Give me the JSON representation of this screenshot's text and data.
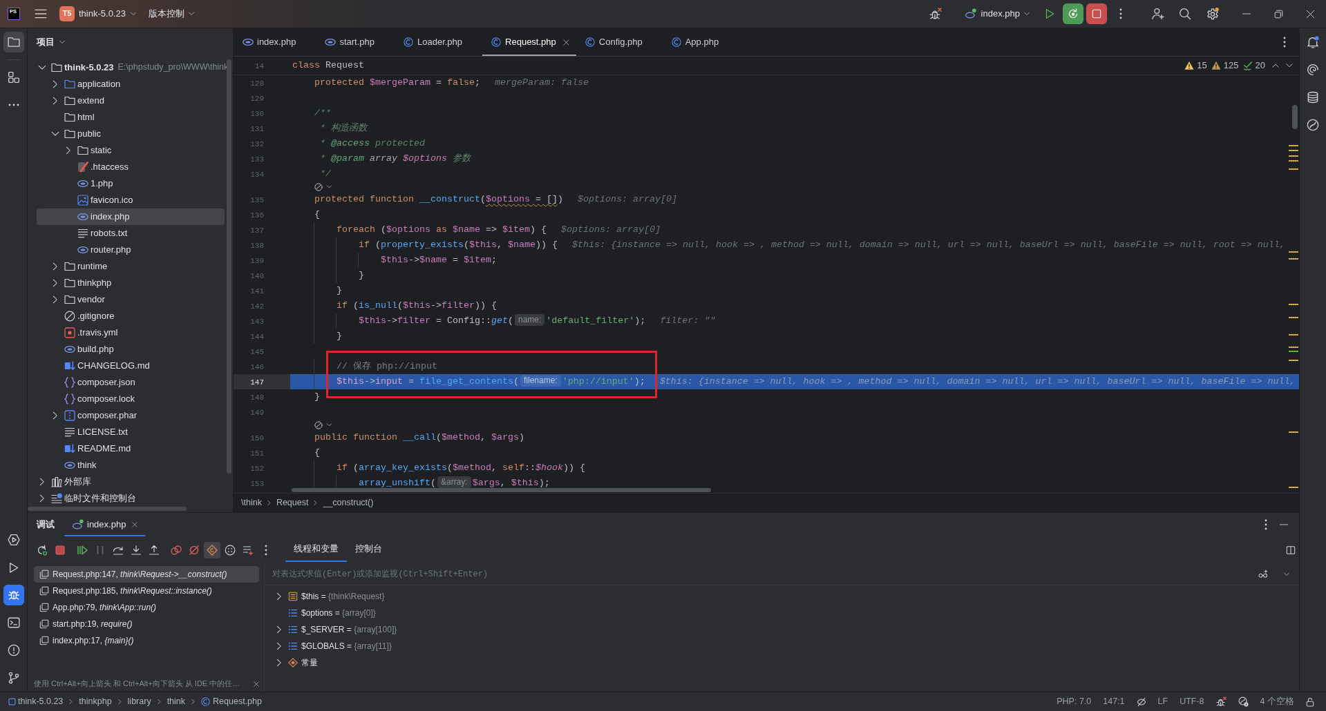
{
  "title_bar": {
    "logo": "PS",
    "project_badge": "T5",
    "project": "think-5.0.23",
    "vcs": "版本控制",
    "run_config": "index.php"
  },
  "left_toolbar": {
    "top": [
      {
        "kind": "folder",
        "selected": true,
        "focused": false
      },
      {
        "kind": "structure",
        "selected": false,
        "focused": false
      },
      {
        "kind": "more",
        "selected": false,
        "focused": false
      }
    ],
    "bottom": [
      {
        "kind": "services",
        "selected": false,
        "focused": false
      },
      {
        "kind": "run",
        "selected": false,
        "focused": false
      },
      {
        "kind": "debug",
        "selected": true,
        "focused": true
      },
      {
        "kind": "terminal",
        "selected": false,
        "focused": false
      },
      {
        "kind": "problems",
        "selected": false,
        "focused": false
      },
      {
        "kind": "git",
        "selected": false,
        "focused": false
      }
    ]
  },
  "project_panel": {
    "title": "项目",
    "tree": [
      {
        "label": "think-5.0.23",
        "path": "E:\\phpstudy_pro\\WWW\\think",
        "kind": "folder",
        "expanded": true,
        "selected": false,
        "children": [
          {
            "label": "application",
            "kind": "source",
            "expanded": false,
            "selected": false
          },
          {
            "label": "extend",
            "kind": "folder",
            "expanded": false,
            "selected": false
          },
          {
            "label": "html",
            "kind": "folder",
            "selected": false
          },
          {
            "label": "public",
            "kind": "folder",
            "expanded": true,
            "selected": false,
            "children": [
              {
                "label": "static",
                "kind": "folder",
                "expanded": false,
                "selected": false
              },
              {
                "label": ".htaccess",
                "kind": "htaccess",
                "selected": false
              },
              {
                "label": "1.php",
                "kind": "php",
                "selected": false
              },
              {
                "label": "favicon.ico",
                "kind": "image",
                "selected": false
              },
              {
                "label": "index.php",
                "kind": "php",
                "selected": true
              },
              {
                "label": "robots.txt",
                "kind": "text",
                "selected": false
              },
              {
                "label": "router.php",
                "kind": "php",
                "selected": false
              }
            ]
          },
          {
            "label": "runtime",
            "kind": "folder",
            "expanded": false,
            "selected": false
          },
          {
            "label": "thinkphp",
            "kind": "folder",
            "expanded": false,
            "selected": false
          },
          {
            "label": "vendor",
            "kind": "folder",
            "expanded": false,
            "selected": false
          },
          {
            "label": ".gitignore",
            "kind": "ignore",
            "selected": false
          },
          {
            "label": ".travis.yml",
            "kind": "yaml",
            "selected": false
          },
          {
            "label": "build.php",
            "kind": "php",
            "selected": false
          },
          {
            "label": "CHANGELOG.md",
            "kind": "markdown",
            "selected": false
          },
          {
            "label": "composer.json",
            "kind": "json",
            "selected": false
          },
          {
            "label": "composer.lock",
            "kind": "json",
            "selected": false
          },
          {
            "label": "composer.phar",
            "kind": "archive",
            "expanded": false,
            "selected": false
          },
          {
            "label": "LICENSE.txt",
            "kind": "text",
            "selected": false
          },
          {
            "label": "README.md",
            "kind": "markdown",
            "selected": false
          },
          {
            "label": "think",
            "kind": "php",
            "selected": false
          }
        ]
      },
      {
        "label": "外部库",
        "kind": "library",
        "expanded": false,
        "selected": false
      },
      {
        "label": "临时文件和控制台",
        "kind": "scratch",
        "expanded": false,
        "selected": false
      }
    ]
  },
  "editor": {
    "tabs": [
      {
        "label": "index.php",
        "kind": "php",
        "selected": false
      },
      {
        "label": "start.php",
        "kind": "php",
        "selected": false
      },
      {
        "label": "Loader.php",
        "kind": "class",
        "selected": false
      },
      {
        "label": "Request.php",
        "kind": "class",
        "selected": true
      },
      {
        "label": "Config.php",
        "kind": "class",
        "selected": false
      },
      {
        "label": "App.php",
        "kind": "class",
        "selected": false
      }
    ],
    "sticky_line": {
      "number": "14",
      "tokens": [
        {
          "kind": "keyword",
          "text": "class"
        },
        {
          "kind": "plain",
          "text": " Request"
        }
      ]
    },
    "inspections": {
      "warnings": "15",
      "weak_warnings": "125",
      "typos": "20"
    },
    "lines": [
      {
        "kind": "line",
        "number": "128",
        "current": false,
        "boxed": false,
        "tokens": [
          {
            "kind": "keyword",
            "text": "    protected "
          },
          {
            "kind": "variable",
            "text": "$mergeParam"
          },
          {
            "kind": "plain",
            "text": " = "
          },
          {
            "kind": "keyword",
            "text": "false"
          },
          {
            "kind": "plain",
            "text": ";"
          }
        ],
        "hint": "mergeParam: false"
      },
      {
        "kind": "line",
        "number": "129",
        "current": false,
        "boxed": false
      },
      {
        "kind": "line",
        "number": "130",
        "current": false,
        "boxed": false,
        "tokens": [
          {
            "kind": "doc",
            "text": "    /**"
          }
        ]
      },
      {
        "kind": "line",
        "number": "131",
        "current": false,
        "boxed": false,
        "tokens": [
          {
            "kind": "doc",
            "text": "     * 构造函数"
          }
        ]
      },
      {
        "kind": "line",
        "number": "132",
        "current": false,
        "boxed": false,
        "tokens": [
          {
            "kind": "doc",
            "text": "     * "
          },
          {
            "kind": "doctag",
            "text": "@access"
          },
          {
            "kind": "doc",
            "text": " protected"
          }
        ]
      },
      {
        "kind": "line",
        "number": "133",
        "current": false,
        "boxed": false,
        "tokens": [
          {
            "kind": "doc",
            "text": "     * "
          },
          {
            "kind": "doctag",
            "text": "@param"
          },
          {
            "kind": "doctype",
            "text": " array "
          },
          {
            "kind": "docvar",
            "text": "$options"
          },
          {
            "kind": "doc",
            "text": " 参数"
          }
        ]
      },
      {
        "kind": "line",
        "number": "134",
        "current": false,
        "boxed": false,
        "tokens": [
          {
            "kind": "doc",
            "text": "     */"
          }
        ]
      },
      {
        "kind": "vision"
      },
      {
        "kind": "line",
        "number": "135",
        "current": false,
        "boxed": false,
        "tokens": [
          {
            "kind": "keyword",
            "text": "    protected function "
          },
          {
            "kind": "function",
            "text": "__construct"
          },
          {
            "kind": "plain",
            "text": "("
          },
          {
            "kind": "warnedvar",
            "text": "$options"
          },
          {
            "kind": "warned",
            "text": " = []"
          },
          {
            "kind": "plain",
            "text": ")"
          }
        ],
        "hint": "$options: array[0]"
      },
      {
        "kind": "line",
        "number": "136",
        "current": false,
        "boxed": false,
        "tokens": [
          {
            "kind": "plain",
            "text": "    {"
          }
        ]
      },
      {
        "kind": "line",
        "number": "137",
        "current": false,
        "boxed": false,
        "tokens": [
          {
            "kind": "keyword",
            "text": "        foreach"
          },
          {
            "kind": "plain",
            "text": " ("
          },
          {
            "kind": "variable",
            "text": "$options"
          },
          {
            "kind": "keyword",
            "text": " as "
          },
          {
            "kind": "variable",
            "text": "$name"
          },
          {
            "kind": "plain",
            "text": " => "
          },
          {
            "kind": "variable",
            "text": "$item"
          },
          {
            "kind": "plain",
            "text": ") {"
          }
        ],
        "hint": "$options: array[0]"
      },
      {
        "kind": "line",
        "number": "138",
        "current": false,
        "boxed": false,
        "tokens": [
          {
            "kind": "keyword",
            "text": "            if"
          },
          {
            "kind": "plain",
            "text": " ("
          },
          {
            "kind": "function",
            "text": "property_exists"
          },
          {
            "kind": "plain",
            "text": "("
          },
          {
            "kind": "variable",
            "text": "$this"
          },
          {
            "kind": "plain",
            "text": ", "
          },
          {
            "kind": "variable",
            "text": "$name"
          },
          {
            "kind": "plain",
            "text": ")) {"
          }
        ],
        "hint": "$this: {instance => null, hook => , method => null, domain => null, url => null, baseUrl => null, baseFile => null, root => null,"
      },
      {
        "kind": "line",
        "number": "139",
        "current": false,
        "boxed": false,
        "tokens": [
          {
            "kind": "variable",
            "text": "                $this"
          },
          {
            "kind": "plain",
            "text": "->"
          },
          {
            "kind": "variable",
            "text": "$name"
          },
          {
            "kind": "plain",
            "text": " = "
          },
          {
            "kind": "variable",
            "text": "$item"
          },
          {
            "kind": "plain",
            "text": ";"
          }
        ]
      },
      {
        "kind": "line",
        "number": "140",
        "current": false,
        "boxed": false,
        "tokens": [
          {
            "kind": "plain",
            "text": "            }"
          }
        ]
      },
      {
        "kind": "line",
        "number": "141",
        "current": false,
        "boxed": false,
        "tokens": [
          {
            "kind": "plain",
            "text": "        }"
          }
        ]
      },
      {
        "kind": "line",
        "number": "142",
        "current": false,
        "boxed": false,
        "tokens": [
          {
            "kind": "keyword",
            "text": "        if"
          },
          {
            "kind": "plain",
            "text": " ("
          },
          {
            "kind": "function",
            "text": "is_null"
          },
          {
            "kind": "plain",
            "text": "("
          },
          {
            "kind": "variable",
            "text": "$this"
          },
          {
            "kind": "plain",
            "text": "->"
          },
          {
            "kind": "field",
            "text": "filter"
          },
          {
            "kind": "plain",
            "text": ")) {"
          }
        ]
      },
      {
        "kind": "line",
        "number": "143",
        "current": false,
        "boxed": false,
        "tokens": [
          {
            "kind": "variable",
            "text": "            $this"
          },
          {
            "kind": "plain",
            "text": "->"
          },
          {
            "kind": "field",
            "text": "filter"
          },
          {
            "kind": "plain",
            "text": " = Config::"
          },
          {
            "kind": "static",
            "text": "get"
          },
          {
            "kind": "plain",
            "text": "("
          },
          {
            "kind": "param",
            "text": "name:"
          },
          {
            "kind": "string",
            "text": "'default_filter'"
          },
          {
            "kind": "plain",
            "text": ");"
          }
        ],
        "hint": "filter: \"\""
      },
      {
        "kind": "line",
        "number": "144",
        "current": false,
        "boxed": false,
        "tokens": [
          {
            "kind": "plain",
            "text": "        }"
          }
        ]
      },
      {
        "kind": "line",
        "number": "145",
        "current": false,
        "boxed": false
      },
      {
        "kind": "line",
        "number": "146",
        "current": false,
        "boxed": true,
        "tokens": [
          {
            "kind": "comment",
            "text": "        // 保存 php://input"
          }
        ]
      },
      {
        "kind": "line",
        "number": "147",
        "current": true,
        "boxed": true,
        "tokens": [
          {
            "kind": "variable",
            "text": "        $this"
          },
          {
            "kind": "plain",
            "text": "->"
          },
          {
            "kind": "field",
            "text": "input"
          },
          {
            "kind": "plain",
            "text": " = "
          },
          {
            "kind": "function",
            "text": "file_get_contents"
          },
          {
            "kind": "plain",
            "text": "("
          },
          {
            "kind": "param",
            "text": "filename:"
          },
          {
            "kind": "string",
            "text": "'php://input'"
          },
          {
            "kind": "plain",
            "text": ");"
          }
        ],
        "hint": "$this: {instance => null, hook => , method => null, domain => null, url => null, baseUrl => null, baseFile => null,"
      },
      {
        "kind": "line",
        "number": "148",
        "current": false,
        "boxed": false,
        "tokens": [
          {
            "kind": "plain",
            "text": "    }"
          }
        ]
      },
      {
        "kind": "line",
        "number": "149",
        "current": false,
        "boxed": false
      },
      {
        "kind": "vision"
      },
      {
        "kind": "line",
        "number": "150",
        "current": false,
        "boxed": false,
        "tokens": [
          {
            "kind": "keyword",
            "text": "    public function "
          },
          {
            "kind": "function",
            "text": "__call"
          },
          {
            "kind": "plain",
            "text": "("
          },
          {
            "kind": "variable",
            "text": "$method"
          },
          {
            "kind": "plain",
            "text": ", "
          },
          {
            "kind": "variable",
            "text": "$args"
          },
          {
            "kind": "plain",
            "text": ")"
          }
        ]
      },
      {
        "kind": "line",
        "number": "151",
        "current": false,
        "boxed": false,
        "tokens": [
          {
            "kind": "plain",
            "text": "    {"
          }
        ]
      },
      {
        "kind": "line",
        "number": "152",
        "current": false,
        "boxed": false,
        "tokens": [
          {
            "kind": "keyword",
            "text": "        if"
          },
          {
            "kind": "plain",
            "text": " ("
          },
          {
            "kind": "function",
            "text": "array_key_exists"
          },
          {
            "kind": "plain",
            "text": "("
          },
          {
            "kind": "variable",
            "text": "$method"
          },
          {
            "kind": "plain",
            "text": ", "
          },
          {
            "kind": "keyword",
            "text": "self"
          },
          {
            "kind": "plain",
            "text": "::"
          },
          {
            "kind": "staticvar",
            "text": "$hook"
          },
          {
            "kind": "plain",
            "text": ")) {"
          }
        ]
      },
      {
        "kind": "line",
        "number": "153",
        "current": false,
        "boxed": false,
        "tokens": [
          {
            "kind": "function",
            "text": "            array_unshift"
          },
          {
            "kind": "plain",
            "text": "("
          },
          {
            "kind": "param",
            "text": "&array:"
          },
          {
            "kind": "variable",
            "text": "$args"
          },
          {
            "kind": "plain",
            "text": ", "
          },
          {
            "kind": "variable",
            "text": "$this"
          },
          {
            "kind": "plain",
            "text": ");"
          }
        ]
      }
    ],
    "breadcrumbs": [
      "\\think",
      "Request",
      "__construct()"
    ]
  },
  "right_toolbar": [
    {
      "kind": "bell",
      "selected": false
    },
    {
      "kind": "spiral",
      "selected": false
    },
    {
      "kind": "database",
      "selected": false
    },
    {
      "kind": "swirl",
      "selected": false
    }
  ],
  "debug_panel": {
    "title": "调试",
    "sessions": [
      {
        "label": "index.php",
        "selected": true
      }
    ],
    "toolbar": [
      [
        {
          "kind": "rerun",
          "selected": false,
          "disabled": false
        },
        {
          "kind": "stop",
          "selected": false,
          "disabled": false
        }
      ],
      [
        {
          "kind": "resume",
          "selected": false,
          "disabled": false
        },
        {
          "kind": "pause",
          "selected": false,
          "disabled": true
        },
        {
          "kind": "stepover",
          "selected": false,
          "disabled": false
        },
        {
          "kind": "stepinto",
          "selected": false,
          "disabled": false
        },
        {
          "kind": "stepout",
          "selected": false,
          "disabled": false
        }
      ],
      [
        {
          "kind": "breakpoints",
          "selected": false,
          "disabled": false
        },
        {
          "kind": "mute",
          "selected": false,
          "disabled": false
        },
        {
          "kind": "exception",
          "selected": true,
          "disabled": false
        },
        {
          "kind": "dots",
          "selected": false,
          "disabled": false
        },
        {
          "kind": "addlist",
          "selected": false,
          "disabled": false
        },
        {
          "kind": "more",
          "selected": false,
          "disabled": false
        }
      ]
    ],
    "tabs": [
      {
        "label": "线程和变量",
        "selected": true
      },
      {
        "label": "控制台",
        "selected": false
      }
    ],
    "frames": [
      {
        "location": "Request.php:147,",
        "method": "think\\Request->__construct()",
        "selected": true
      },
      {
        "location": "Request.php:185,",
        "method": "think\\Request::instance()",
        "selected": false
      },
      {
        "location": "App.php:79,",
        "method": "think\\App::run()",
        "selected": false
      },
      {
        "location": "start.php:19,",
        "method": "require()",
        "selected": false
      },
      {
        "location": "index.php:17,",
        "method": "{main}()",
        "selected": false
      }
    ],
    "frames_hint": "使用 Ctrl+Alt+向上箭头 和 Ctrl+Alt+向下箭头 从 IDE 中的任…",
    "evaluate": {
      "placeholder": "对表达式求值(Enter)或添加监视(Ctrl+Shift+Enter)"
    },
    "variables": [
      {
        "name": "$this",
        "assign": "=",
        "value": "{think\\Request}",
        "kind": "object",
        "expanded": false
      },
      {
        "name": "$options",
        "assign": "=",
        "value": "{array[0]}",
        "kind": "array"
      },
      {
        "name": "$_SERVER",
        "assign": "=",
        "value": "{array[100]}",
        "kind": "array",
        "expanded": false
      },
      {
        "name": "$GLOBALS",
        "assign": "=",
        "value": "{array[11]}",
        "kind": "array",
        "expanded": false
      },
      {
        "name": "常量",
        "kind": "constant",
        "expanded": false
      }
    ]
  },
  "status_bar": {
    "path": [
      {
        "label": "think-5.0.23",
        "kind": "module"
      },
      {
        "label": "thinkphp",
        "kind": "dir"
      },
      {
        "label": "library",
        "kind": "dir"
      },
      {
        "label": "think",
        "kind": "dir"
      },
      {
        "label": "Request.php",
        "kind": "class"
      }
    ],
    "php_version": "PHP: 7.0",
    "position": "147:1",
    "line_separator": "LF",
    "encoding": "UTF-8",
    "indent": "4 个空格"
  }
}
